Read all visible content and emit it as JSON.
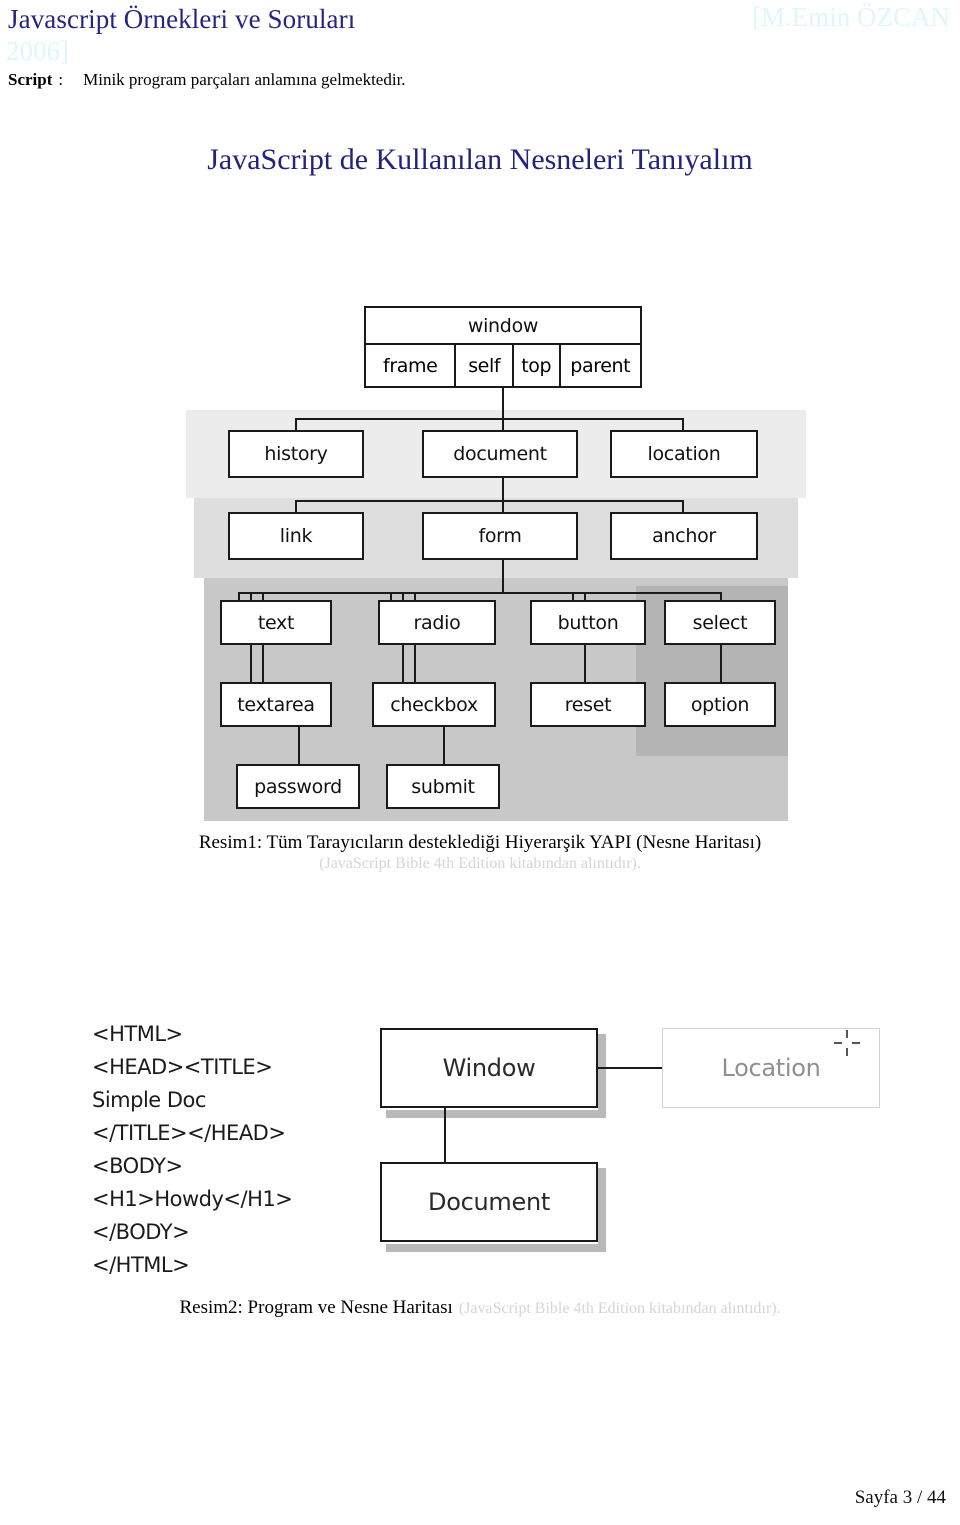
{
  "header": {
    "title": "Javascript Örnekleri ve Soruları",
    "author": "[M.Emin ÖZCAN",
    "year": "2006]",
    "title_color": "#242483",
    "watermark_color": "#dff6fb"
  },
  "intro": {
    "term": "Script",
    "colon": ":",
    "text": "Minik program parçaları anlamına gelmektedir."
  },
  "section": {
    "heading": "JavaScript de Kullanılan Nesneleri Tanıyalım",
    "heading_color": "#222280"
  },
  "figure1": {
    "caption_main": "Resim1: Tüm Tarayıcıların desteklediği Hiyerarşik YAPI  (Nesne Haritası)",
    "caption_sub": "(JavaScript Bible 4th Edition kitabından alıntıdır).",
    "nodes": {
      "window": "window",
      "frame": "frame",
      "self": "self",
      "top": "top",
      "parent": "parent",
      "history": "history",
      "document": "document",
      "location": "location",
      "link": "link",
      "form": "form",
      "anchor": "anchor",
      "text": "text",
      "radio": "radio",
      "button": "button",
      "select": "select",
      "textarea": "textarea",
      "checkbox": "checkbox",
      "reset": "reset",
      "option": "option",
      "password": "password",
      "submit": "submit"
    },
    "band_colors": {
      "band1": "#ececec",
      "band2": "#dedede",
      "band3": "#c8c8c8",
      "band4": "#b4b4b4"
    }
  },
  "figure2": {
    "code": "<HTML>\n<HEAD><TITLE>\nSimple Doc\n</TITLE></HEAD>\n<BODY>\n<H1>Howdy</H1>\n</BODY>\n</HTML>",
    "nodes": {
      "window": "Window",
      "document": "Document",
      "location": "Location"
    },
    "caption_main": "Resim2: Program ve Nesne Haritası",
    "caption_sub": "(JavaScript Bible 4th Edition kitabından alıntıdır)."
  },
  "footer": {
    "page_label": "Sayfa 3 / 44"
  }
}
